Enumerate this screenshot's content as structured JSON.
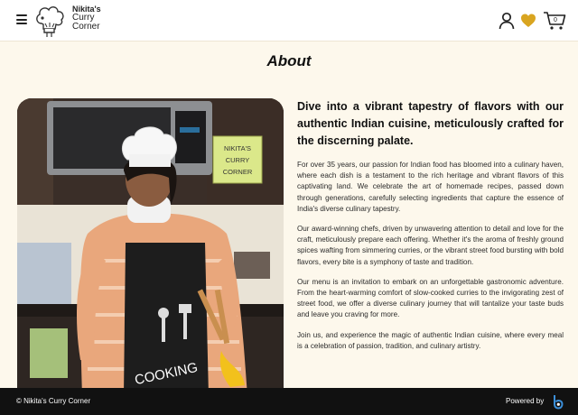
{
  "header": {
    "brand_line1": "Nikita's",
    "brand_line2": "Curry",
    "brand_line3": "Corner",
    "cart_count": "0",
    "icons": [
      "menu-icon",
      "chef-hat-logo",
      "user-icon",
      "heart-icon",
      "cart-icon"
    ],
    "accent_color": "#d9a520"
  },
  "main": {
    "title": "About",
    "photo_text": {
      "sign_line1": "NIKITA'S",
      "sign_line2": "CURRY",
      "sign_line3": "CORNER",
      "apron_text": "COOKING"
    },
    "lead": "Dive into a vibrant tapestry of flavors with our authentic Indian cuisine, meticulously crafted for the discerning palate.",
    "paragraphs": [
      "For over 35 years, our passion for Indian food has bloomed into a culinary haven, where each dish is a testament to the rich heritage and vibrant flavors of this captivating land. We celebrate the art of homemade recipes, passed down through generations, carefully selecting ingredients that capture the essence of India's diverse culinary tapestry.",
      "Our award-winning chefs, driven by unwavering attention to detail and love for the craft, meticulously prepare each offering. Whether it's the aroma of freshly ground spices wafting from simmering curries, or the vibrant street food bursting with bold flavors, every bite is a symphony of taste and tradition.",
      "Our menu is an invitation to embark on an unforgettable gastronomic adventure. From the heart-warming comfort of slow-cooked curries to the invigorating zest of street food, we offer a diverse culinary journey that will tantalize your taste buds and leave you craving for more.",
      "Join us, and experience the magic of authentic Indian cuisine, where every meal is a celebration of passion, tradition, and culinary artistry."
    ]
  },
  "footer": {
    "copyright": "© Nikita's Curry Corner",
    "powered_by": "Powered by"
  }
}
